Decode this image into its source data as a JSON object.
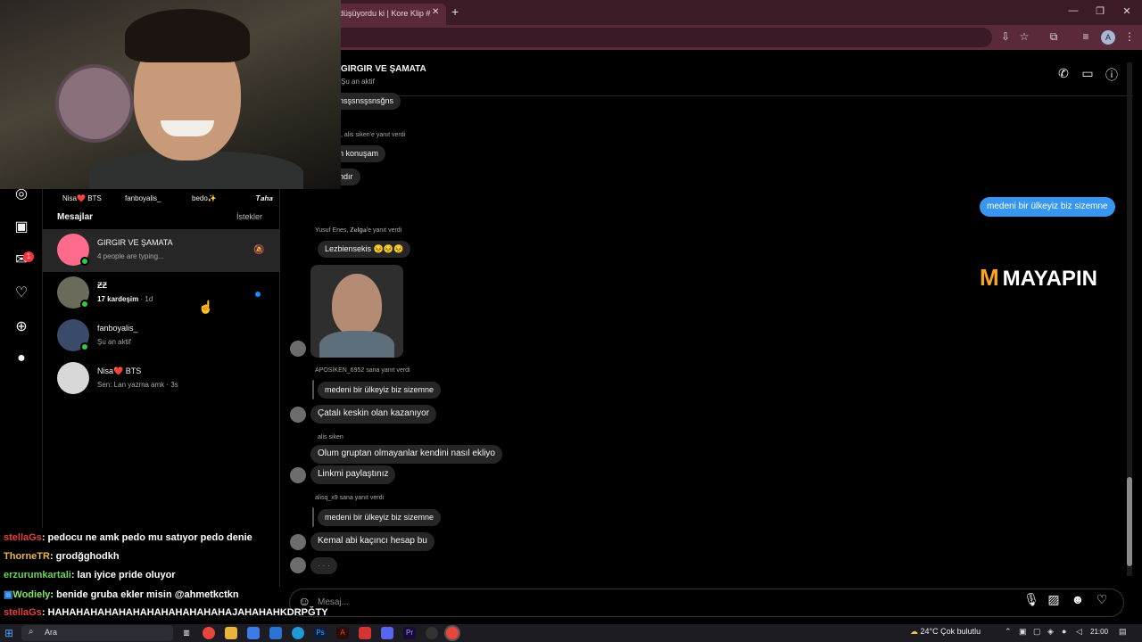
{
  "browser": {
    "tab_title": "düşüyordu ki | Kore Klip #",
    "tab_close": "✕",
    "new_tab": "+",
    "window_controls": {
      "minimize": "—",
      "restore": "❐",
      "close": "✕"
    },
    "profile_initial": "A",
    "toolbar_icons": [
      "install-icon",
      "star-icon",
      "extensions-icon",
      "media-icon",
      "profile-icon",
      "menu-icon"
    ]
  },
  "sidebar": {
    "icons": [
      "explore-icon",
      "reels-icon",
      "messenger-icon",
      "heart-icon",
      "create-icon",
      "profile-icon"
    ],
    "notification_badge": "1"
  },
  "stories": [
    "Nisa❤️ BTS",
    "fanboyalis_",
    "bedo✨",
    "𝑻𝒂𝒉𝒂"
  ],
  "inbox": {
    "title": "Mesajlar",
    "requests": "İstekler",
    "conversations": [
      {
        "name": "GIRGIR VE ŞAMATA",
        "sub": "4 people are typing...",
        "online": true,
        "muted": true,
        "selected": true,
        "avatar_color": "#ff6b8a"
      },
      {
        "name": "ƵƵ",
        "sub_bold": "17 kardeşim",
        "sub": " · 1d",
        "online": true,
        "unread": true,
        "avatar_color": "#6b6b5a"
      },
      {
        "name": "fanboyalis_",
        "sub": "Şu an aktif",
        "online": true,
        "avatar_color": "#3a4a6a"
      },
      {
        "name": "Nisa❤️ BTS",
        "sub": "Sen: Lan yazma amk · 3s",
        "online": false,
        "avatar_color": "#d8d8d8"
      }
    ]
  },
  "chat": {
    "title": "GIRGIR VE ŞAMATA",
    "status": "Şu an aktif",
    "header_icons": [
      "phone-icon",
      "video-icon",
      "info-icon"
    ],
    "messages": {
      "m1": "nsşsnsşsnsğns",
      "m2_meta": ", alis siken'e yanıt verdi",
      "m2": "n konuşam",
      "m3": "ndır",
      "mine1": "medeni bir ülkeyiz biz sizemne",
      "m4_meta": "Yusuf Enes, 𝐙𝐞𝐥𝐠𝐚'e yanıt verdi",
      "m4": "Lezbiensekis 😣😣😣",
      "m5_meta": "APOSİKEN_6952 sana yanıt verdi",
      "m5_quote": "medeni bir ülkeyiz biz sizemne",
      "m5": "Çatalı keskin olan kazanıyor",
      "m6_meta": "alis siken",
      "m6": "Olum gruptan olmayanlar kendini nasıl ekliyo",
      "m7": "Linkmi paylaştınız",
      "m8_meta": "alisq_x9 sana yanıt verdi",
      "m8_quote": "medeni bir ülkeyiz biz sizemne",
      "m8": "Kemal abi kaçıncı hesap bu",
      "typing": "· · ·"
    },
    "watermark": "MAYAPIN",
    "input_placeholder": "Mesaj...",
    "input_icons": [
      "mic-icon",
      "image-icon",
      "sticker-icon",
      "heart-icon"
    ]
  },
  "stream_chat": [
    {
      "user": "stellaGs",
      "user_color": "#e0413e",
      "text": ": pedocu ne amk pedo mu satıyor pedo denie"
    },
    {
      "user": "ThorneTR",
      "user_color": "#e6b84a",
      "text": ": grodğghodkh"
    },
    {
      "user": "erzurumkartali",
      "user_color": "#6ad35a",
      "text": ": lan iyice pride oluyor"
    },
    {
      "user": "Wodiely",
      "user_color": "#8be06a",
      "text": ": benide gruba ekler misin @ahmetkctkn"
    },
    {
      "user": "stellaGs",
      "user_color": "#e0413e",
      "text": ": HAHAHAHAHAHAHAHAHAHAHAHAHAJAHAHAHKDRPĞTY"
    }
  ],
  "taskbar": {
    "search_placeholder": "Ara",
    "weather": "24°C  Çok bulutlu",
    "time": "21:00"
  },
  "colors": {
    "accent_blue": "#3797f0",
    "bubble_grey": "#262626",
    "online_green": "#2ecc40",
    "tab_bar": "#3b1b26"
  }
}
